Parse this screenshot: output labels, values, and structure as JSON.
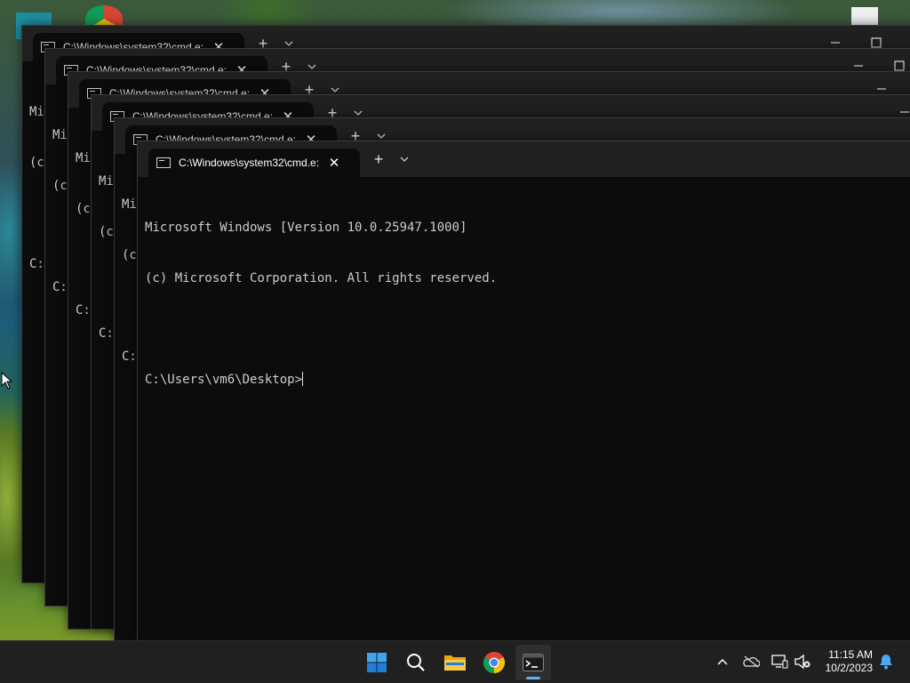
{
  "windows": [
    {
      "title": "C:\\Windows\\system32\\cmd.e:",
      "lines": [
        "Mi",
        "(c",
        "",
        "C:"
      ]
    },
    {
      "title": "C:\\Windows\\system32\\cmd.e:",
      "lines": [
        "Mi",
        "(c",
        "",
        "C:"
      ]
    },
    {
      "title": "C:\\Windows\\system32\\cmd.e:",
      "lines": [
        "Mi",
        "(c",
        "",
        "C:"
      ]
    },
    {
      "title": "C:\\Windows\\system32\\cmd.e:",
      "lines": [
        "Mi",
        "(c",
        "",
        "C:"
      ]
    },
    {
      "title": "C:\\Windows\\system32\\cmd.e:",
      "lines": [
        "Mi",
        "(c",
        "",
        "C:"
      ]
    },
    {
      "title": "C:\\Windows\\system32\\cmd.e:",
      "lines": [
        "Microsoft Windows [Version 10.0.25947.1000]",
        "(c) Microsoft Corporation. All rights reserved.",
        "",
        "C:\\Users\\vm6\\Desktop>"
      ]
    }
  ],
  "tab_close_glyph": "✕",
  "new_tab_glyph": "+",
  "taskbar": {
    "apps": [
      {
        "name": "start-button",
        "icon": "windows-logo-icon"
      },
      {
        "name": "search-button",
        "icon": "search-icon"
      },
      {
        "name": "file-explorer-button",
        "icon": "folder-icon"
      },
      {
        "name": "chrome-button",
        "icon": "chrome-icon"
      },
      {
        "name": "terminal-button",
        "icon": "terminal-icon",
        "active": true
      }
    ],
    "tray_icons": [
      "chevron-up-icon",
      "onedrive-icon",
      "network-icon",
      "volume-muted-icon"
    ],
    "time": "11:15 AM",
    "date": "10/2/2023",
    "notification_icon": "bell-icon"
  },
  "colors": {
    "terminal_bg": "#0c0c0c",
    "tabbar_bg": "#202020",
    "text": "#cccccc",
    "taskbar_bg": "#202020",
    "accent": "#5fb2f2"
  }
}
